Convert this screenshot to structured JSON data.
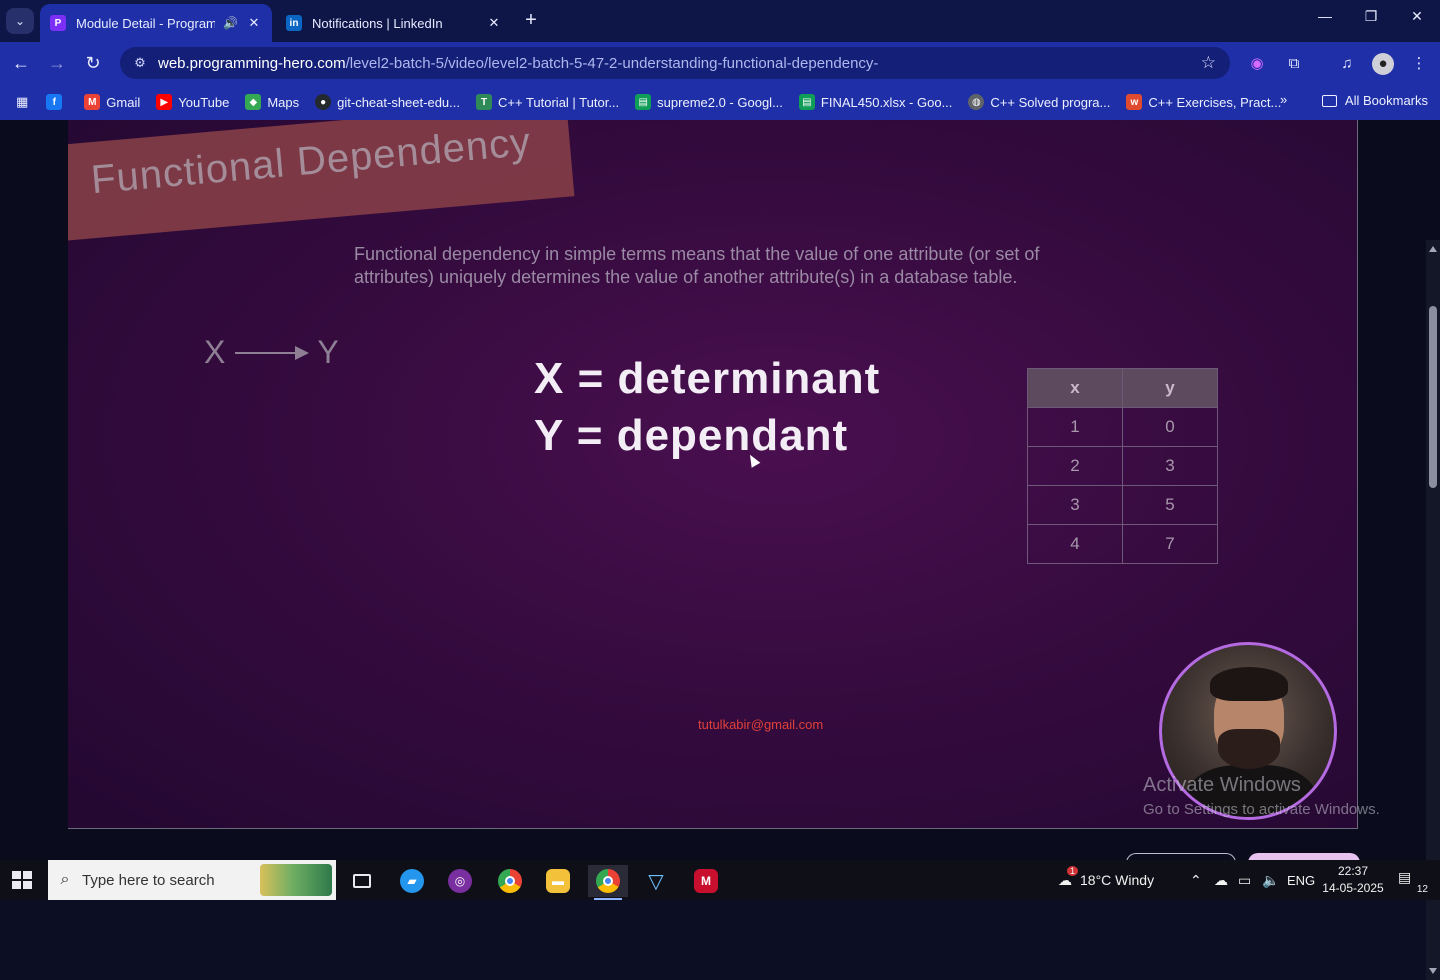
{
  "browser": {
    "tabs": [
      {
        "title": "Module Detail - Programmi",
        "active": true,
        "favicon": "programming-hero-icon",
        "audio": true
      },
      {
        "title": "Notifications | LinkedIn",
        "active": false,
        "favicon": "linkedin-icon"
      }
    ],
    "new_tab": "+",
    "url_host": "web.programming-hero.com",
    "url_path": "/level2-batch-5/video/level2-batch-5-47-2-understanding-functional-dependency-",
    "bookmarks": [
      {
        "label": "",
        "icon": "facebook-icon",
        "color": "#1877f2"
      },
      {
        "label": "Gmail",
        "icon": "gmail-icon",
        "color": "#ea4335"
      },
      {
        "label": "YouTube",
        "icon": "youtube-icon",
        "color": "#ff0000"
      },
      {
        "label": "Maps",
        "icon": "maps-icon",
        "color": "#34a853"
      },
      {
        "label": "git-cheat-sheet-edu...",
        "icon": "github-icon",
        "color": "#24292e"
      },
      {
        "label": "C++ Tutorial | Tutor...",
        "icon": "tutorial-icon",
        "color": "#2e8b57"
      },
      {
        "label": "supreme2.0 - Googl...",
        "icon": "sheets-icon",
        "color": "#0f9d58"
      },
      {
        "label": "FINAL450.xlsx - Goo...",
        "icon": "sheets-icon",
        "color": "#0f9d58"
      },
      {
        "label": "C++ Solved progra...",
        "icon": "globe-icon",
        "color": "#5f6368"
      },
      {
        "label": "C++ Exercises, Pract...",
        "icon": "w3r-icon",
        "color": "#e04a2f"
      }
    ],
    "more_bookmarks": "»",
    "all_bookmarks": "All Bookmarks"
  },
  "video": {
    "banner_title": "Functional Dependency",
    "definition": "Functional dependency in simple terms means that the value of one attribute (or set of attributes) uniquely determines the value of another attribute(s) in a database table.",
    "arrow_left": "X",
    "arrow_right": "Y",
    "eq1": "X = determinant",
    "eq2": "Y = dependant",
    "table": {
      "headers": [
        "x",
        "y"
      ],
      "rows": [
        [
          "1",
          "0"
        ],
        [
          "2",
          "3"
        ],
        [
          "3",
          "5"
        ],
        [
          "4",
          "7"
        ]
      ]
    },
    "email": "tutulkabir@gmail.com"
  },
  "watermark": {
    "line1": "Activate Windows",
    "line2": "Go to Settings to activate Windows."
  },
  "taskbar": {
    "search_placeholder": "Type here to search",
    "weather": "18°C  Windy",
    "weather_badge": "1",
    "lang": "ENG",
    "time": "22:37",
    "date": "14-05-2025",
    "notif_count": "12"
  }
}
